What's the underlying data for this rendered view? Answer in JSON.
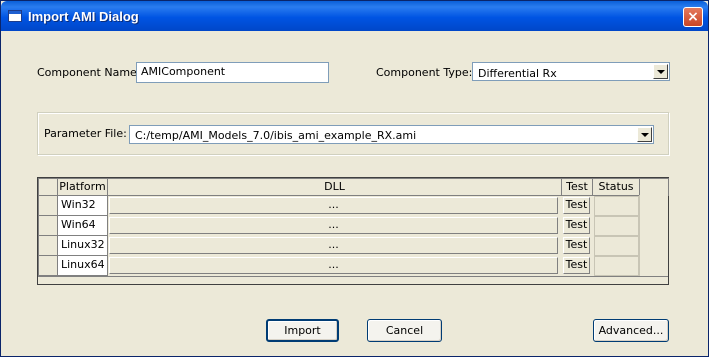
{
  "window": {
    "title": "Import AMI Dialog",
    "close_glyph": "×"
  },
  "form": {
    "component_name_label": "Component Name:",
    "component_name_value": "AMIComponent",
    "component_type_label": "Component Type:",
    "component_type_value": "Differential Rx",
    "parameter_file_label": "Parameter File:",
    "parameter_file_value": "C:/temp/AMI_Models_7.0/ibis_ami_example_RX.ami"
  },
  "table": {
    "headers": {
      "platform": "Platform",
      "dll": "DLL",
      "test": "Test",
      "status": "Status"
    },
    "rows": [
      {
        "platform": "Win32",
        "dll": "...",
        "test": "Test",
        "status": ""
      },
      {
        "platform": "Win64",
        "dll": "...",
        "test": "Test",
        "status": ""
      },
      {
        "platform": "Linux32",
        "dll": "...",
        "test": "Test",
        "status": ""
      },
      {
        "platform": "Linux64",
        "dll": "...",
        "test": "Test",
        "status": ""
      }
    ]
  },
  "buttons": {
    "import": "Import",
    "cancel": "Cancel",
    "advanced": "Advanced..."
  },
  "icons": {
    "app": "window-icon",
    "close": "close-icon",
    "dropdown": "chevron-down-icon"
  },
  "colors": {
    "titlebar": "#0054e3",
    "face": "#ece9d8",
    "close": "#c94525"
  }
}
